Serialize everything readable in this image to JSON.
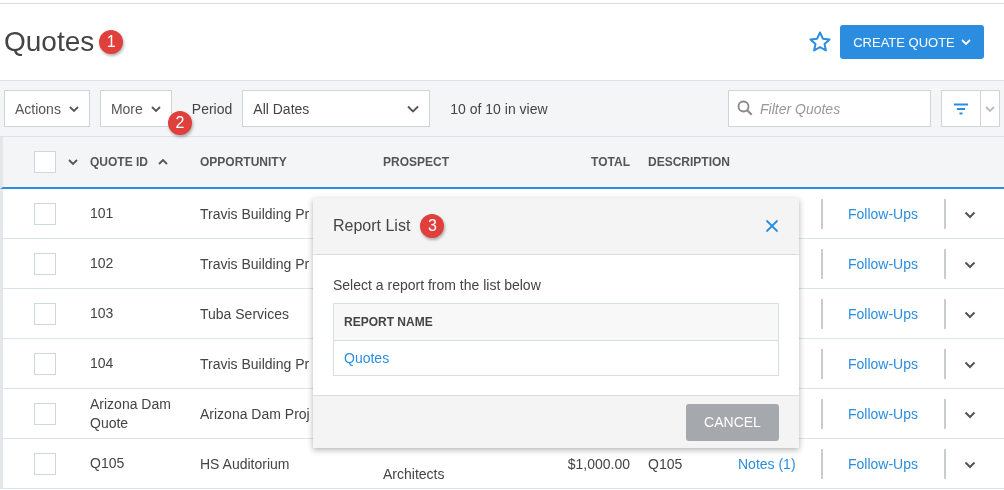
{
  "page": {
    "title": "Quotes",
    "title_badge": "1",
    "create_button": "CREATE QUOTE"
  },
  "toolbar": {
    "actions": "Actions",
    "more": "More",
    "more_badge": "2",
    "period_label": "Period",
    "period_value": "All Dates",
    "count": "10 of 10 in view",
    "filter": {
      "placeholder": "Filter Quotes"
    }
  },
  "table": {
    "header_checkbox": {
      "checked": false
    },
    "columns": [
      {
        "label": "QUOTE ID",
        "sorted": true
      },
      {
        "label": "OPPORTUNITY",
        "sorted": false
      },
      {
        "label": "PROSPECT",
        "sorted": false
      },
      {
        "label": "TOTAL",
        "sorted": false
      },
      {
        "label": "DESCRIPTION",
        "sorted": false
      }
    ],
    "rows": [
      {
        "checked": false,
        "quote_id": "101",
        "opportunity": "Travis Building Pr",
        "followups": "Follow-Ups"
      },
      {
        "checked": false,
        "quote_id": "102",
        "opportunity": "Travis Building Pr",
        "followups": "Follow-Ups"
      },
      {
        "checked": false,
        "quote_id": "103",
        "opportunity": "Tuba Services",
        "followups": "Follow-Ups"
      },
      {
        "checked": false,
        "quote_id": "104",
        "opportunity": "Travis Building Pr",
        "followups": "Follow-Ups"
      },
      {
        "checked": false,
        "quote_id": "Arizona Dam Quote",
        "opportunity": "Arizona Dam Proj",
        "followups": "Follow-Ups"
      },
      {
        "checked": false,
        "quote_id": "Q105",
        "opportunity": "HS Auditorium",
        "prospect": "Architects",
        "total": "$1,000.00",
        "description": "Q105",
        "notes": "Notes (1)",
        "followups": "Follow-Ups"
      }
    ]
  },
  "dialog": {
    "title": "Report List",
    "badge": "3",
    "instruction": "Select a report from the list below",
    "column": "REPORT NAME",
    "reports": [
      "Quotes"
    ],
    "cancel": "CANCEL"
  }
}
